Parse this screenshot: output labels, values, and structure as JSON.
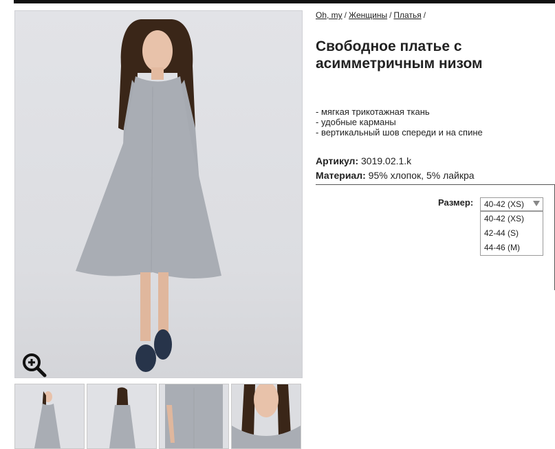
{
  "breadcrumb": {
    "home": "Oh, my",
    "women": "Женщины",
    "dresses": "Платья",
    "sep": "/"
  },
  "product": {
    "title": "Свободное платье с асимметричным низом",
    "features": [
      "- мягкая трикотажная ткань",
      "- удобные карманы",
      "- вертикальный шов спереди и на спине"
    ],
    "sku_label": "Артикул:",
    "sku_value": "3019.02.1.k",
    "material_label": "Материал:",
    "material_value": "95% хлопок, 5% лайкра"
  },
  "size": {
    "label": "Размер:",
    "selected": "40-42 (XS)",
    "options": [
      "40-42 (XS)",
      "42-44 (S)",
      "44-46 (M)"
    ]
  },
  "icons": {
    "zoom": "zoom-in-icon",
    "dropdown": "chevron-down-icon"
  },
  "colors": {
    "dress": "#a9adb4",
    "shoes": "#27344a",
    "hair": "#3a2618",
    "background": "#dcdde1"
  }
}
